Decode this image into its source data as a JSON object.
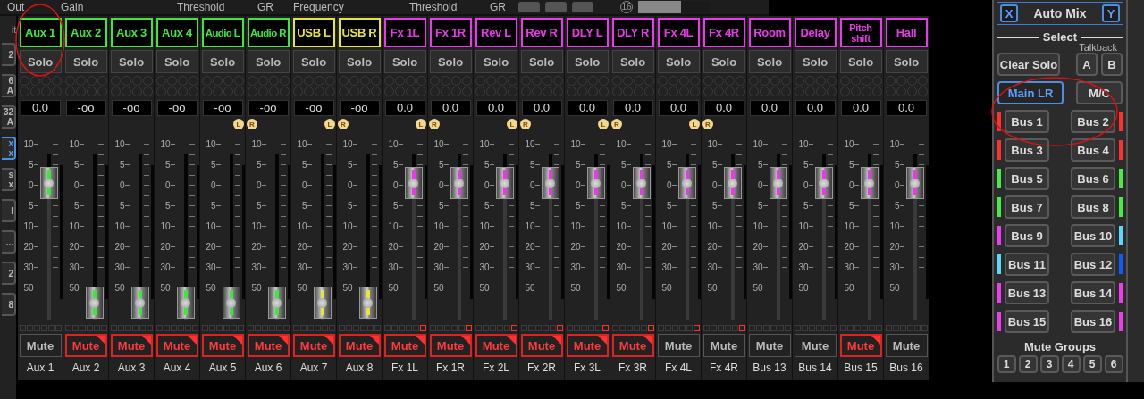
{
  "top_bar": {
    "labels": [
      "Out",
      "Gain",
      "Threshold",
      "GR",
      "Frequency",
      "Threshold",
      "GR"
    ],
    "knob_value": "16",
    "slider": {
      "level": 0.6
    }
  },
  "left_tabs": {
    "caption": "it",
    "items": [
      {
        "label": "2",
        "selected": false
      },
      {
        "label": "6 A",
        "selected": false
      },
      {
        "label": "32 A",
        "selected": false
      },
      {
        "label": "x x",
        "selected": true
      },
      {
        "label": "s x",
        "selected": false
      },
      {
        "label": "l",
        "selected": false
      },
      {
        "label": "...",
        "selected": false
      },
      {
        "label": "2",
        "selected": false
      },
      {
        "label": "8",
        "selected": false
      }
    ]
  },
  "channels": [
    {
      "name": "Aux 1",
      "color": "#3fe63f",
      "solo": "Solo",
      "value": "0.0",
      "scale": "10\n5\n0\n5\n10\n20\n30\n50",
      "level": 0.72,
      "clip": false,
      "mute": "Mute",
      "muted": false,
      "label": "Aux 1"
    },
    {
      "name": "Aux 2",
      "color": "#3fe63f",
      "solo": "Solo",
      "value": "-oo",
      "scale": "10\n5\n0\n5\n10\n20\n30\n50",
      "level": 0,
      "clip": false,
      "mute": "Mute",
      "muted": true,
      "label": "Aux 2"
    },
    {
      "name": "Aux 3",
      "color": "#3fe63f",
      "solo": "Solo",
      "value": "-oo",
      "scale": "10\n5\n0\n5\n10\n20\n30\n50",
      "level": 0,
      "clip": false,
      "mute": "Mute",
      "muted": true,
      "label": "Aux 3"
    },
    {
      "name": "Aux 4",
      "color": "#3fe63f",
      "solo": "Solo",
      "value": "-oo",
      "scale": "10\n5\n0\n5\n10\n20\n30\n50",
      "level": 0,
      "clip": false,
      "mute": "Mute",
      "muted": true,
      "label": "Aux 4"
    },
    {
      "name": "Audio L",
      "color": "#3fe63f",
      "solo": "Solo",
      "value": "-oo",
      "link": "L",
      "scale": "10\n5\n0\n5\n10\n20\n30\n50",
      "level": 0,
      "clip": false,
      "mute": "Mute",
      "muted": true,
      "label": "Aux 5"
    },
    {
      "name": "Audio R",
      "color": "#3fe63f",
      "solo": "Solo",
      "value": "-oo",
      "link": "R",
      "scale": "10\n5\n0\n5\n10\n20\n30\n50",
      "level": 0,
      "clip": false,
      "mute": "Mute",
      "muted": true,
      "label": "Aux 6"
    },
    {
      "name": "USB L",
      "color": "#e6e63a",
      "solo": "Solo",
      "value": "-oo",
      "link": "L",
      "scale": "10\n5\n0\n5\n10\n20\n30\n50",
      "level": 0,
      "clip": false,
      "mute": "Mute",
      "muted": true,
      "label": "Aux 7"
    },
    {
      "name": "USB R",
      "color": "#e6e63a",
      "solo": "Solo",
      "value": "-oo",
      "link": "R",
      "scale": "10\n5\n0\n5\n10\n20\n30\n50",
      "level": 0,
      "clip": false,
      "mute": "Mute",
      "muted": true,
      "label": "Aux 8"
    },
    {
      "name": "Fx 1L",
      "color": "#e93ae9",
      "solo": "Solo",
      "value": "0.0",
      "link": "L",
      "scale": "10\n5\n0\n5\n10\n20\n30\n50",
      "level": 0.72,
      "clip": true,
      "mute": "Mute",
      "muted": true,
      "label": "Fx 1L"
    },
    {
      "name": "Fx 1R",
      "color": "#e93ae9",
      "solo": "Solo",
      "value": "0.0",
      "link": "R",
      "scale": "10\n5\n0\n5\n10\n20\n30\n50",
      "level": 0.72,
      "clip": true,
      "mute": "Mute",
      "muted": true,
      "label": "Fx 1R"
    },
    {
      "name": "Rev L",
      "color": "#e93ae9",
      "solo": "Solo",
      "value": "0.0",
      "link": "L",
      "scale": "10\n5\n0\n5\n10\n20\n30\n50",
      "level": 0.72,
      "clip": true,
      "mute": "Mute",
      "muted": true,
      "label": "Fx 2L"
    },
    {
      "name": "Rev R",
      "color": "#e93ae9",
      "solo": "Solo",
      "value": "0.0",
      "link": "R",
      "scale": "10\n5\n0\n5\n10\n20\n30\n50",
      "level": 0.72,
      "clip": true,
      "mute": "Mute",
      "muted": true,
      "label": "Fx 2R"
    },
    {
      "name": "DLY L",
      "color": "#e93ae9",
      "solo": "Solo",
      "value": "0.0",
      "link": "L",
      "scale": "10\n5\n0\n5\n10\n20\n30\n50",
      "level": 0.72,
      "clip": true,
      "mute": "Mute",
      "muted": true,
      "label": "Fx 3L"
    },
    {
      "name": "DLY R",
      "color": "#e93ae9",
      "solo": "Solo",
      "value": "0.0",
      "link": "R",
      "scale": "10\n5\n0\n5\n10\n20\n30\n50",
      "level": 0.72,
      "clip": true,
      "mute": "Mute",
      "muted": true,
      "label": "Fx 3R"
    },
    {
      "name": "Fx 4L",
      "color": "#e93ae9",
      "solo": "Solo",
      "value": "0.0",
      "link": "L",
      "scale": "10\n5\n0\n5\n10\n20\n30\n50",
      "level": 0.72,
      "clip": true,
      "mute": "Mute",
      "muted": false,
      "label": "Fx 4L"
    },
    {
      "name": "Fx 4R",
      "color": "#e93ae9",
      "solo": "Solo",
      "value": "0.0",
      "link": "R",
      "scale": "10\n5\n0\n5\n10\n20\n30\n50",
      "level": 0.72,
      "clip": true,
      "mute": "Mute",
      "muted": false,
      "label": "Fx 4R"
    },
    {
      "name": "Room",
      "color": "#e93ae9",
      "solo": "Solo",
      "value": "0.0",
      "scale": "10\n5\n0\n5\n10\n20\n30\n50",
      "level": 0.72,
      "clip": false,
      "mute": "Mute",
      "muted": false,
      "label": "Bus 13"
    },
    {
      "name": "Delay",
      "color": "#e93ae9",
      "solo": "Solo",
      "value": "0.0",
      "scale": "10\n5\n0\n5\n10\n20\n30\n50",
      "level": 0.72,
      "clip": false,
      "mute": "Mute",
      "muted": false,
      "label": "Bus 14"
    },
    {
      "name": "Pitch shift",
      "color": "#e93ae9",
      "solo": "Solo",
      "value": "0.0",
      "scale": "10\n5\n0\n5\n10\n20\n30\n50",
      "level": 0.72,
      "clip": false,
      "mute": "Mute",
      "muted": true,
      "label": "Bus 15"
    },
    {
      "name": "Hall",
      "color": "#e93ae9",
      "solo": "Solo",
      "value": "0.0",
      "scale": "10\n5\n0\n5\n10\n20\n30\n50",
      "level": 0.72,
      "clip": false,
      "mute": "Mute",
      "muted": false,
      "label": "Bus 16"
    }
  ],
  "auto_mix": {
    "title": "Auto Mix",
    "x": "X",
    "y": "Y"
  },
  "select": {
    "title": "Select",
    "talkback": "Talkback",
    "clear_solo": "Clear Solo",
    "talkback_buttons": [
      "A",
      "B"
    ],
    "targets": [
      {
        "label": "Main LR",
        "selected": true
      },
      {
        "label": "M/C",
        "selected": false
      }
    ],
    "buses": [
      {
        "label": "Bus 1",
        "color": "#ff3030"
      },
      {
        "label": "Bus 2",
        "color": "#ff3030"
      },
      {
        "label": "Bus 3",
        "color": "#ff3030"
      },
      {
        "label": "Bus 4",
        "color": "#ff3030"
      },
      {
        "label": "Bus 5",
        "color": "#44ee44"
      },
      {
        "label": "Bus 6",
        "color": "#44ee44"
      },
      {
        "label": "Bus 7",
        "color": "#44ee44"
      },
      {
        "label": "Bus 8",
        "color": "#44ee44"
      },
      {
        "label": "Bus 9",
        "color": "#f03cf0"
      },
      {
        "label": "Bus 10",
        "color": "#5ad8ff"
      },
      {
        "label": "Bus 11",
        "color": "#5ad8ff"
      },
      {
        "label": "Bus 12",
        "color": "#0a5cff"
      },
      {
        "label": "Bus 13",
        "color": "#f03cf0"
      },
      {
        "label": "Bus 14",
        "color": "#f03cf0"
      },
      {
        "label": "Bus 15",
        "color": "#f03cf0"
      },
      {
        "label": "Bus 16",
        "color": "#f03cf0"
      }
    ]
  },
  "mute_groups": {
    "title": "Mute Groups",
    "buttons": [
      "1",
      "2",
      "3",
      "4",
      "5",
      "6"
    ]
  }
}
